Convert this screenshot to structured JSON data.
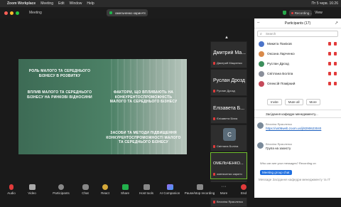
{
  "menubar": {
    "apple": "",
    "app": "Zoom Workplace",
    "items": [
      "Meeting",
      "Edit",
      "Window",
      "Help"
    ],
    "right": "Пт 5 черв.  16:26"
  },
  "topbar": {
    "title": "Meeting",
    "share_label": "омельченко каринч'є",
    "recording_label": "Recording...",
    "view_label": "View"
  },
  "stage": {
    "line1": "РОЛЬ МАЛОГО ТА СЕРЕДНЬОГО БІЗНЕСУ В РОЗВИТКУ",
    "line2": "ВПЛИВ МАЛОГО ТА СЕРЕДНЬОГО БІЗНЕСУ НА РИНКОВІ ВІДНОСИНИ",
    "line3": "ФАКТОРИ, ЩО ВПЛИВАЮТЬ НА КОНКУРЕНТОСПРОМОЖНІСТЬ МАЛОГО ТА СЕРЕДНЬОГО БІЗНЕСУ",
    "line4": "ЗАСОБИ ТА МЕТОДИ ПІДВИЩЕННЯ КОНКУРЕНТОСПРОМОЖНОСТІ МАЛОГО ТА СЕРЕДНЬОГО БІЗНЕСУ"
  },
  "thumbs": [
    {
      "name": "Дмитрий Ма...",
      "sub": "Дмитрий Мациенко"
    },
    {
      "name": "Руслан Дрозд",
      "sub": "Руслан Дрозд"
    },
    {
      "name": "Елізавета Б...",
      "sub": "Єлізавета Білик"
    },
    {
      "name": "",
      "avatar": "С",
      "sub": "Світлана Боліла"
    },
    {
      "name": "ОМЕЛЬЧЕНКО...",
      "sub": "омельченко каринч"
    },
    {
      "name": "",
      "sub": "Віталіна Ярмоленко"
    }
  ],
  "panel": {
    "title": "Participants (17)",
    "search_placeholder": "Search",
    "participants": [
      "Микита Паніков",
      "Оксана Ларченко",
      "Руслан Дрозд",
      "Світлана Боліла",
      "Олексій Поміркий"
    ],
    "invite": "Invite",
    "mute_all": "Mute all",
    "more": "More",
    "chat_title": "Засідання кафедри менеджменту...",
    "messages": [
      {
        "from": "Віталіна Ярмоленко",
        "time": "16:02",
        "body": "https://us06web.zoom.us/j/8290623040"
      },
      {
        "from": "Віталіна Ярмоленко",
        "time": "16:02",
        "body": "Група на захисту"
      }
    ],
    "who_can_see": "Who can see your messages? Recording on",
    "to_chip": "Meeting group chat",
    "input_placeholder": "Message Засідання кафедри менеджменту та ІТ"
  },
  "toolbar": {
    "audio": "Audio",
    "video": "Video",
    "participants": "Participants",
    "participants_count": "17",
    "chat": "Chat",
    "react": "React",
    "share": "Share",
    "host_tools": "Host tools",
    "ai": "AI Companion",
    "pause": "Pause/stop recording",
    "more": "More",
    "end": "End"
  }
}
